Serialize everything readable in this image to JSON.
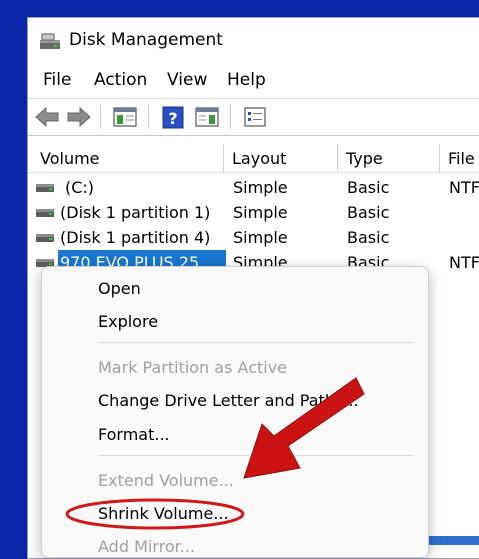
{
  "window": {
    "title": "Disk Management"
  },
  "menu": [
    "File",
    "Action",
    "View",
    "Help"
  ],
  "toolbar": {
    "icons": [
      "back-arrow-icon",
      "forward-arrow-icon",
      "console-tree-icon",
      "help-icon",
      "action-pane-icon",
      "properties-icon"
    ]
  },
  "table": {
    "columns": [
      "Volume",
      "Layout",
      "Type",
      "File"
    ],
    "rows": [
      {
        "volume": "(C:)",
        "layout": "Simple",
        "type": "Basic",
        "fs": "NTF"
      },
      {
        "volume": "(Disk 1 partition 1)",
        "layout": "Simple",
        "type": "Basic",
        "fs": ""
      },
      {
        "volume": "(Disk 1 partition 4)",
        "layout": "Simple",
        "type": "Basic",
        "fs": ""
      },
      {
        "volume": "970 EVO PLUS 25",
        "layout": "Simple",
        "type": "Basic",
        "fs": "NTF",
        "selected": true
      }
    ]
  },
  "context_menu": {
    "items": [
      {
        "label": "Open",
        "enabled": true
      },
      {
        "label": "Explore",
        "enabled": true
      },
      {
        "label": "Mark Partition as Active",
        "enabled": false
      },
      {
        "label": "Change Drive Letter and Paths...",
        "enabled": true
      },
      {
        "label": "Format...",
        "enabled": true
      },
      {
        "label": "Extend Volume...",
        "enabled": false
      },
      {
        "label": "Shrink Volume...",
        "enabled": true
      },
      {
        "label": "Add Mirror...",
        "enabled": false
      }
    ]
  },
  "annotation": {
    "arrow_color": "#d01818",
    "highlight_color": "#d01818",
    "highlighted_item": "Shrink Volume..."
  }
}
